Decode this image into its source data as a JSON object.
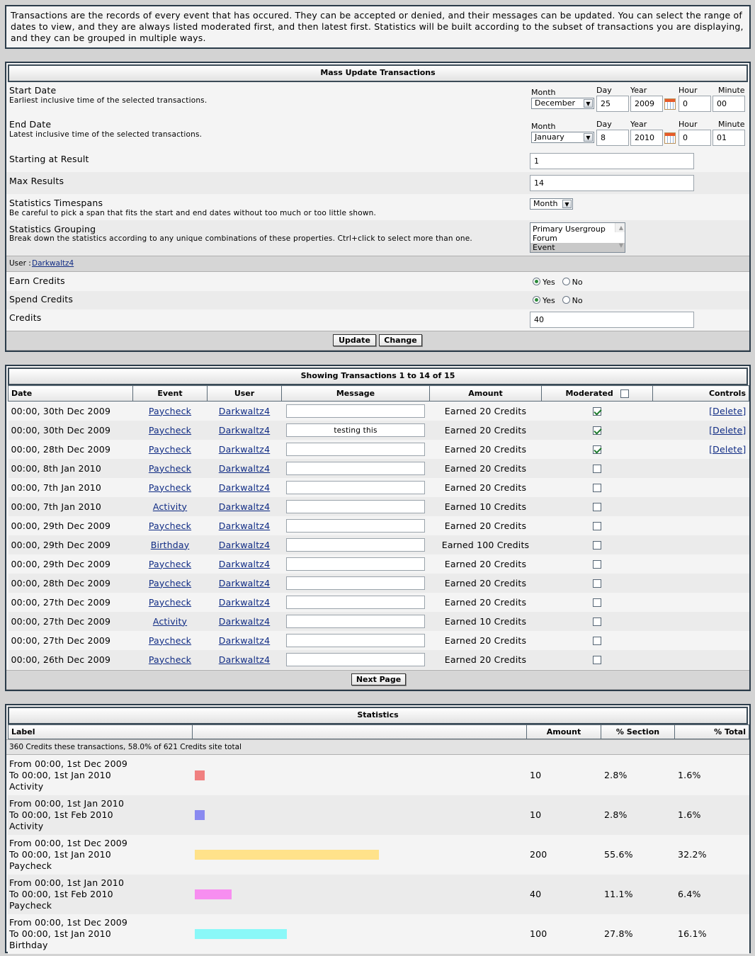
{
  "intro": "Transactions are the records of every event that has occured. They can be accepted or denied, and their messages can be updated. You can select the range of dates to view, and they are always listed moderated first, and then latest first. Statistics will be built according to the subset of transactions you are displaying, and they can be grouped in multiple ways.",
  "mass_update": {
    "title": "Mass Update Transactions",
    "date_labels": {
      "month": "Month",
      "day": "Day",
      "year": "Year",
      "hour": "Hour",
      "minute": "Minute"
    },
    "start": {
      "label": "Start Date",
      "hint": "Earliest inclusive time of the selected transactions.",
      "month": "December",
      "day": "25",
      "year": "2009",
      "hour": "0",
      "minute": "00"
    },
    "end": {
      "label": "End Date",
      "hint": "Latest inclusive time of the selected transactions.",
      "month": "January",
      "day": "8",
      "year": "2010",
      "hour": "0",
      "minute": "01"
    },
    "starting_result": {
      "label": "Starting at Result",
      "value": "1"
    },
    "max_results": {
      "label": "Max Results",
      "value": "14"
    },
    "timespans": {
      "label": "Statistics Timespans",
      "hint": "Be careful to pick a span that fits the start and end dates without too much or too little shown.",
      "value": "Month"
    },
    "grouping": {
      "label": "Statistics Grouping",
      "hint": "Break down the statistics according to any unique combinations of these properties. Ctrl+click to select more than one.",
      "options": [
        "Primary Usergroup",
        "Forum",
        "Event"
      ],
      "selected": "Event"
    },
    "user": {
      "prefix": "User : ",
      "name": "Darkwaltz4"
    },
    "earn_credits": {
      "label": "Earn Credits",
      "value": "Yes"
    },
    "spend_credits": {
      "label": "Spend Credits",
      "value": "Yes"
    },
    "yes": "Yes",
    "no": "No",
    "credits": {
      "label": "Credits",
      "value": "40"
    },
    "update_button": "Update",
    "change_button": "Change"
  },
  "transactions": {
    "title": "Showing Transactions 1 to 14 of 15",
    "columns": {
      "date": "Date",
      "event": "Event",
      "user": "User",
      "message": "Message",
      "amount": "Amount",
      "moderated": "Moderated",
      "controls": "Controls"
    },
    "rows": [
      {
        "date": "00:00, 30th Dec 2009",
        "event": "Paycheck",
        "user": "Darkwaltz4",
        "message": "",
        "amount": "Earned 20 Credits",
        "moderated": true,
        "control": "[Delete]"
      },
      {
        "date": "00:00, 30th Dec 2009",
        "event": "Paycheck",
        "user": "Darkwaltz4",
        "message": "testing this",
        "amount": "Earned 20 Credits",
        "moderated": true,
        "control": "[Delete]"
      },
      {
        "date": "00:00, 28th Dec 2009",
        "event": "Paycheck",
        "user": "Darkwaltz4",
        "message": "",
        "amount": "Earned 20 Credits",
        "moderated": true,
        "control": "[Delete]"
      },
      {
        "date": "00:00, 8th Jan 2010",
        "event": "Paycheck",
        "user": "Darkwaltz4",
        "message": "",
        "amount": "Earned 20 Credits",
        "moderated": false,
        "control": ""
      },
      {
        "date": "00:00, 7th Jan 2010",
        "event": "Paycheck",
        "user": "Darkwaltz4",
        "message": "",
        "amount": "Earned 20 Credits",
        "moderated": false,
        "control": ""
      },
      {
        "date": "00:00, 7th Jan 2010",
        "event": "Activity",
        "user": "Darkwaltz4",
        "message": "",
        "amount": "Earned 10 Credits",
        "moderated": false,
        "control": ""
      },
      {
        "date": "00:00, 29th Dec 2009",
        "event": "Paycheck",
        "user": "Darkwaltz4",
        "message": "",
        "amount": "Earned 20 Credits",
        "moderated": false,
        "control": ""
      },
      {
        "date": "00:00, 29th Dec 2009",
        "event": "Birthday",
        "user": "Darkwaltz4",
        "message": "",
        "amount": "Earned 100 Credits",
        "moderated": false,
        "control": ""
      },
      {
        "date": "00:00, 29th Dec 2009",
        "event": "Paycheck",
        "user": "Darkwaltz4",
        "message": "",
        "amount": "Earned 20 Credits",
        "moderated": false,
        "control": ""
      },
      {
        "date": "00:00, 28th Dec 2009",
        "event": "Paycheck",
        "user": "Darkwaltz4",
        "message": "",
        "amount": "Earned 20 Credits",
        "moderated": false,
        "control": ""
      },
      {
        "date": "00:00, 27th Dec 2009",
        "event": "Paycheck",
        "user": "Darkwaltz4",
        "message": "",
        "amount": "Earned 20 Credits",
        "moderated": false,
        "control": ""
      },
      {
        "date": "00:00, 27th Dec 2009",
        "event": "Activity",
        "user": "Darkwaltz4",
        "message": "",
        "amount": "Earned 10 Credits",
        "moderated": false,
        "control": ""
      },
      {
        "date": "00:00, 27th Dec 2009",
        "event": "Paycheck",
        "user": "Darkwaltz4",
        "message": "",
        "amount": "Earned 20 Credits",
        "moderated": false,
        "control": ""
      },
      {
        "date": "00:00, 26th Dec 2009",
        "event": "Paycheck",
        "user": "Darkwaltz4",
        "message": "",
        "amount": "Earned 20 Credits",
        "moderated": false,
        "control": ""
      }
    ],
    "next_button": "Next Page"
  },
  "statistics": {
    "title": "Statistics",
    "columns": {
      "label": "Label",
      "amount": "Amount",
      "pct_section": "% Section",
      "pct_total": "% Total"
    },
    "summary": "360 Credits these transactions, 58.0% of 621 Credits site total",
    "bar_max": 200,
    "rows": [
      {
        "from": "From 00:00, 1st Dec 2009",
        "to": "To 00:00, 1st Jan 2010",
        "event": "Activity",
        "amount": 10,
        "amount_text": "10",
        "pct_section": "2.8%",
        "pct_total": "1.6%",
        "color": "#f08080"
      },
      {
        "from": "From 00:00, 1st Jan 2010",
        "to": "To 00:00, 1st Feb 2010",
        "event": "Activity",
        "amount": 10,
        "amount_text": "10",
        "pct_section": "2.8%",
        "pct_total": "1.6%",
        "color": "#8a8af0"
      },
      {
        "from": "From 00:00, 1st Dec 2009",
        "to": "To 00:00, 1st Jan 2010",
        "event": "Paycheck",
        "amount": 200,
        "amount_text": "200",
        "pct_section": "55.6%",
        "pct_total": "32.2%",
        "color": "#ffe28a"
      },
      {
        "from": "From 00:00, 1st Jan 2010",
        "to": "To 00:00, 1st Feb 2010",
        "event": "Paycheck",
        "amount": 40,
        "amount_text": "40",
        "pct_section": "11.1%",
        "pct_total": "6.4%",
        "color": "#f78ef0"
      },
      {
        "from": "From 00:00, 1st Dec 2009",
        "to": "To 00:00, 1st Jan 2010",
        "event": "Birthday",
        "amount": 100,
        "amount_text": "100",
        "pct_section": "27.8%",
        "pct_total": "16.1%",
        "color": "#8af8f8"
      }
    ]
  }
}
